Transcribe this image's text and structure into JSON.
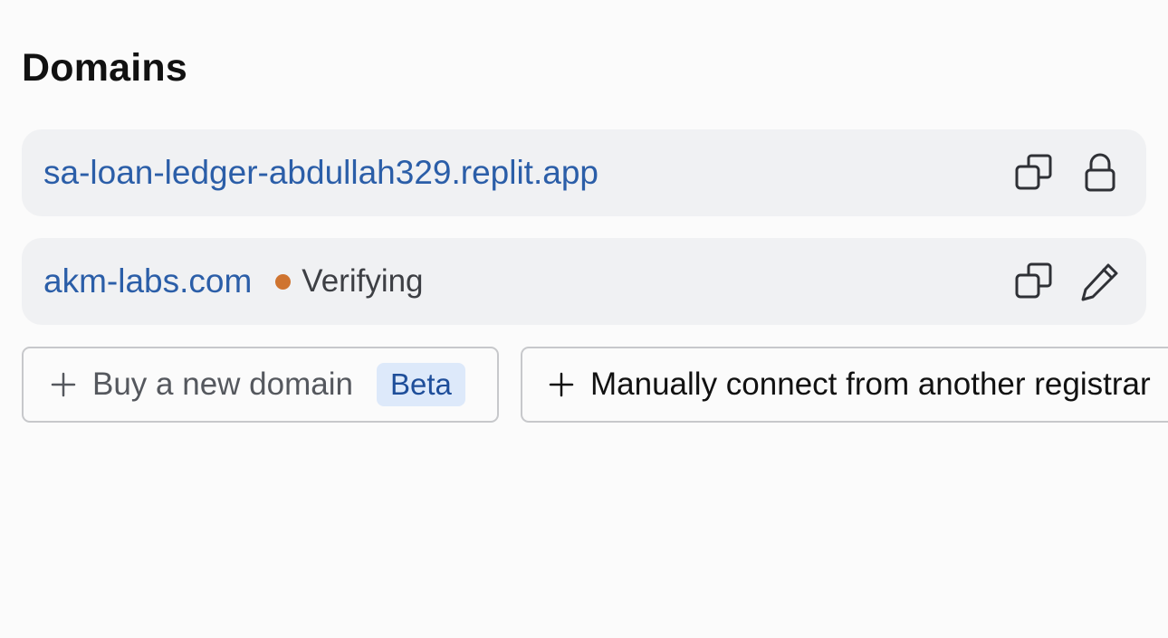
{
  "section": {
    "title": "Domains"
  },
  "domains": [
    {
      "name": "sa-loan-ledger-abdullah329.replit.app",
      "actions": [
        "copy-icon",
        "lock-icon"
      ]
    },
    {
      "name": "akm-labs.com",
      "status": "Verifying",
      "status_color": "#cf7430",
      "actions": [
        "copy-icon",
        "pencil-icon"
      ]
    }
  ],
  "buttons": {
    "buy_label": "Buy a new domain",
    "buy_badge": "Beta",
    "connect_label": "Manually connect from another registrar"
  },
  "colors": {
    "link": "#2b5ea8",
    "row_background": "#f0f1f3",
    "badge_background": "#dde9fa",
    "badge_text": "#1e4e9a",
    "status_dot": "#cf7430"
  }
}
